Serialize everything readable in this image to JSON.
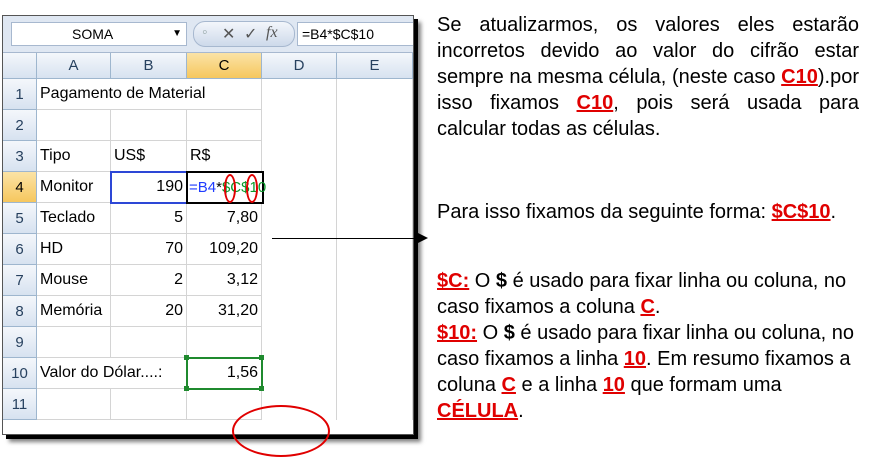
{
  "excel": {
    "name_box": "SOMA",
    "name_box_arrow": "▼",
    "fx_label": "fx",
    "cancel_glyph": "✕",
    "enter_glyph": "✓",
    "formula_bar_value": "=B4*$C$10",
    "column_headers": [
      "A",
      "B",
      "C",
      "D",
      "E"
    ],
    "row_headers": [
      "1",
      "2",
      "3",
      "4",
      "5",
      "6",
      "7",
      "8",
      "9",
      "10",
      "11"
    ],
    "rows": [
      {
        "a": "Pagamento de Material",
        "b": "",
        "c": ""
      },
      {
        "a": "",
        "b": "",
        "c": ""
      },
      {
        "a": "Tipo",
        "b": "US$",
        "c": "R$"
      },
      {
        "a": "Monitor",
        "b": "190",
        "c": ""
      },
      {
        "a": "Teclado",
        "b": "5",
        "c": "7,80"
      },
      {
        "a": "HD",
        "b": "70",
        "c": "109,20"
      },
      {
        "a": "Mouse",
        "b": "2",
        "c": "3,12"
      },
      {
        "a": "Memória",
        "b": "20",
        "c": "31,20"
      },
      {
        "a": "",
        "b": "",
        "c": ""
      },
      {
        "a": "Valor do Dólar....:",
        "b": "",
        "c": "1,56"
      },
      {
        "a": "",
        "b": "",
        "c": ""
      }
    ],
    "edit_cell": {
      "part1": "=B4",
      "part2": "*",
      "part3": "$C$10"
    },
    "accent_blue": "#2d47d6",
    "accent_green": "#1f8a2e",
    "annotation_red": "#e00000"
  },
  "explanation": {
    "p1_a": "Se atualizarmos, os valores eles estarão incorretos devido ao valor do cifrão estar sempre na mesma célula, (neste caso ",
    "p1_c10a": "C10",
    "p1_b": ").por isso fixamos ",
    "p1_c10b": "C10",
    "p1_c": ", pois será usada para calcular todas as células.",
    "p2_a": "Para isso fixamos da seguinte forma: ",
    "p2_ref": "$C$10",
    "p2_b": ".",
    "p3_label": "$C:",
    "p3_a": "  O ",
    "p3_dollar": "$",
    "p3_b": " é usado para fixar linha ou coluna, no caso fixamos a coluna ",
    "p3_c": "C",
    "p3_end": ".",
    "p4_label": "$10:",
    "p4_a": " O ",
    "p4_dollar": "$",
    "p4_b": " é usado para fixar linha ou coluna, no caso fixamos a linha ",
    "p4_10": "10",
    "p4_c": ". Em resumo fixamos a coluna ",
    "p4_col": "C",
    "p4_d": " e a linha ",
    "p4_row": "10",
    "p4_e": " que formam uma ",
    "p4_celula": "CÉLULA",
    "p4_end": "."
  }
}
